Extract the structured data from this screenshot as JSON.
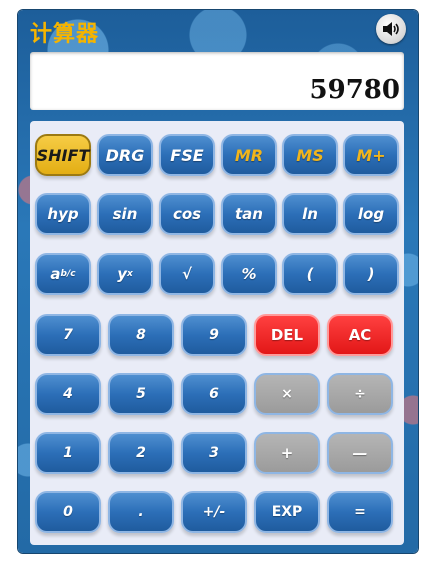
{
  "app": {
    "title": "计算器",
    "sound_icon": "speaker-icon"
  },
  "display": {
    "value": "59780"
  },
  "rows": {
    "r1": [
      "SHIFT",
      "DRG",
      "FSE",
      "MR",
      "MS",
      "M+"
    ],
    "r2": [
      "hyp",
      "sin",
      "cos",
      "tan",
      "ln",
      "log"
    ],
    "r3": {
      "abc_base": "a",
      "abc_sup": "b/c",
      "yx_base": "y",
      "yx_sup": "x",
      "sqrt": "√",
      "percent": "%",
      "lparen": "(",
      "rparen": ")"
    },
    "r4": [
      "7",
      "8",
      "9",
      "DEL",
      "AC"
    ],
    "r5": [
      "4",
      "5",
      "6",
      "×",
      "÷"
    ],
    "r6": [
      "1",
      "2",
      "3",
      "+",
      "—"
    ],
    "r7": [
      "0",
      ".",
      "+/-",
      "EXP",
      "="
    ]
  },
  "colors": {
    "accent_gold": "#f1b51c",
    "danger_red": "#e21717",
    "button_blue": "#2c6fb8",
    "operator_gray": "#9b9b9b"
  }
}
